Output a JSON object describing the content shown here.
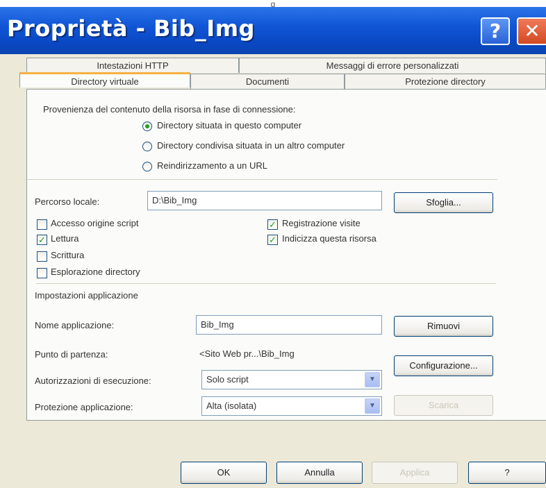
{
  "window": {
    "top_caption": "g",
    "title": "Proprietà - Bib_Img",
    "help_button": "?",
    "close_button": "✕"
  },
  "tabs": {
    "row_top": [
      "Intestazioni HTTP",
      "Messaggi di errore personalizzati"
    ],
    "row_bottom": [
      "Directory virtuale",
      "Documenti",
      "Protezione directory"
    ]
  },
  "source": {
    "label": "Provenienza del contenuto della risorsa in fase di connessione:",
    "options": [
      {
        "label": "Directory situata in questo computer",
        "selected": true
      },
      {
        "label": "Directory condivisa situata in un altro computer",
        "selected": false
      },
      {
        "label": "Reindirizzamento a un URL",
        "selected": false
      }
    ]
  },
  "local_path": {
    "label": "Percorso locale:",
    "value": "D:\\Bib_Img",
    "browse_button": "Sfoglia..."
  },
  "checkboxes": {
    "left": [
      {
        "label": "Accesso origine script",
        "checked": false
      },
      {
        "label": "Lettura",
        "checked": true
      },
      {
        "label": "Scrittura",
        "checked": false
      },
      {
        "label": "Esplorazione directory",
        "checked": false
      }
    ],
    "right": [
      {
        "label": "Registrazione visite",
        "checked": true
      },
      {
        "label": "Indicizza questa risorsa",
        "checked": true
      }
    ]
  },
  "app_settings": {
    "section_label": "Impostazioni applicazione",
    "name_label": "Nome applicazione:",
    "name_value": "Bib_Img",
    "remove_button": "Rimuovi",
    "start_label": "Punto di partenza:",
    "start_value": "<Sito Web pr...\\Bib_Img",
    "config_button": "Configurazione...",
    "exec_label": "Autorizzazioni di esecuzione:",
    "exec_value": "Solo script",
    "protection_label": "Protezione applicazione:",
    "protection_value": "Alta (isolata)",
    "unload_button": "Scarica"
  },
  "footer": {
    "ok": "OK",
    "cancel": "Annulla",
    "apply": "Applica",
    "help": "?"
  },
  "colors": {
    "title_bar": "#0a48c4",
    "check_mark": "#21a121",
    "dialog_bg": "#ece9d8"
  }
}
